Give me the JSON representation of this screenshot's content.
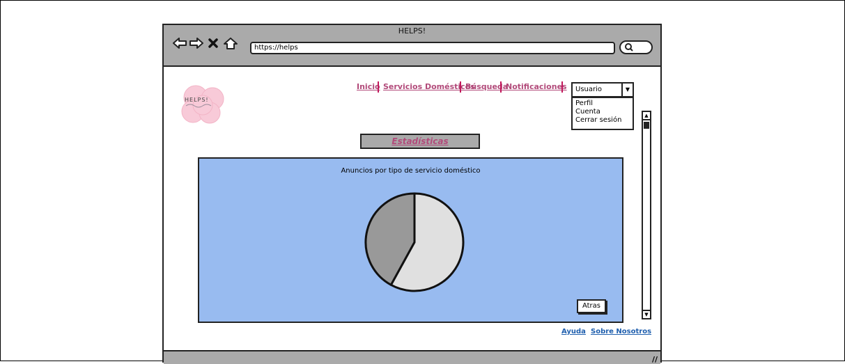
{
  "window": {
    "title": "HELPS!",
    "url": "https://helps"
  },
  "logo_text": "HELPS!",
  "nav": {
    "items": [
      "Inicio",
      "Servicios Domésticos",
      "Búsqueda",
      "Notificaciones"
    ]
  },
  "user_menu": {
    "selected": "Usuario",
    "options": [
      "Perfil",
      "Cuenta",
      "Cerrar sesión"
    ]
  },
  "page_title": "Estadísticas",
  "chart_data": {
    "type": "pie",
    "title": "Anuncios por tipo de servicio doméstico",
    "values": [
      58,
      42
    ],
    "colors": [
      "#e0e0e0",
      "#999999"
    ]
  },
  "buttons": {
    "back": "Atras"
  },
  "footer": {
    "help": "Ayuda",
    "about": "Sobre Nosotros"
  },
  "colors": {
    "link": "#b24a7a",
    "panel": "#98bbf0",
    "chrome": "#aaaaaa"
  }
}
